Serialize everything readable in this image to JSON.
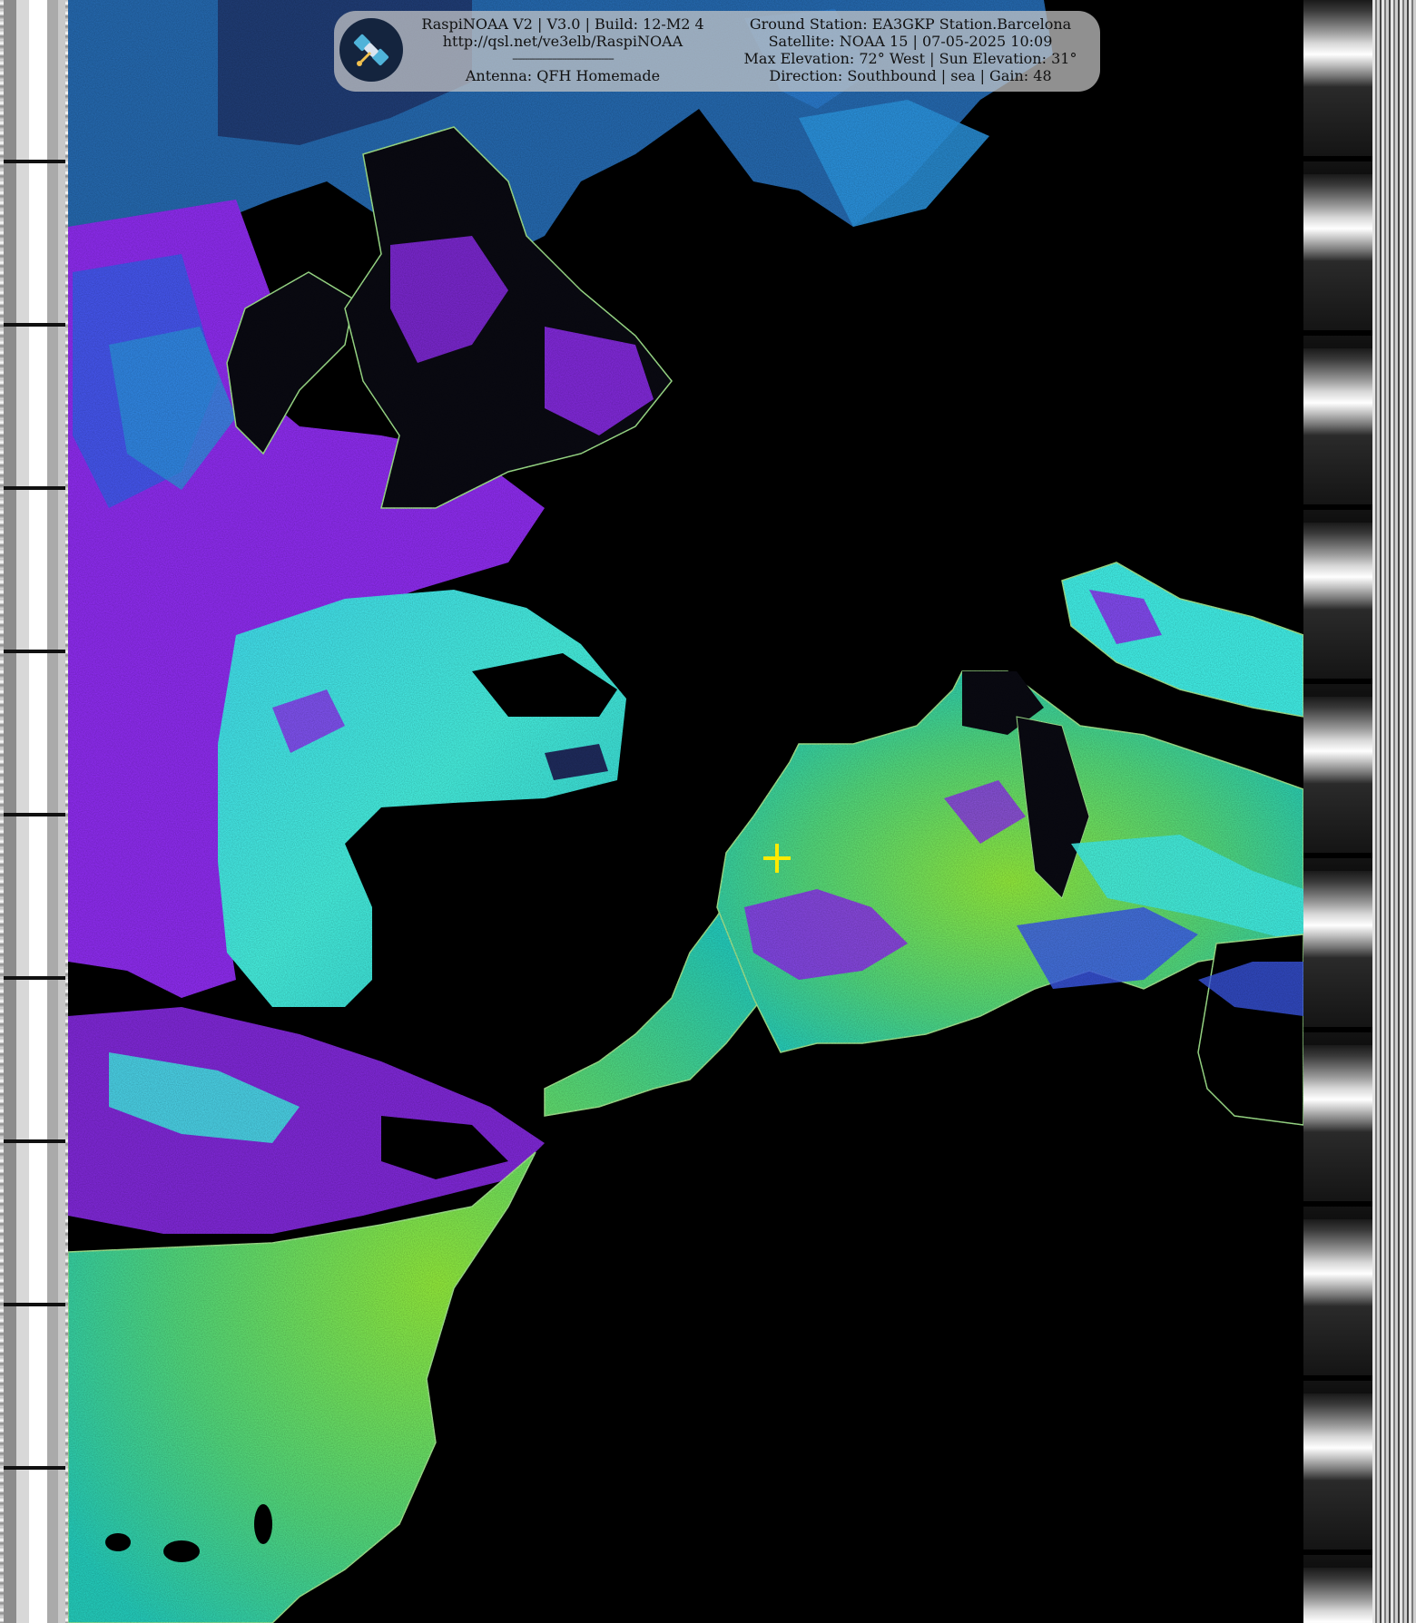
{
  "overlay": {
    "left_lines": [
      "RaspiNOAA V2 | V3.0 | Build: 12-M2 4",
      "http://qsl.net/ve3elb/RaspiNOAA",
      "-----------------------------------------",
      "Antenna: QFH Homemade"
    ],
    "right_lines": [
      "Ground Station: EA3GKP Station.Barcelona",
      "Satellite: NOAA 15 | 07-05-2025 10:09",
      "Max Elevation: 72° West | Sun Elevation: 31°",
      "Direction: Southbound | sea | Gain: 48"
    ],
    "logo_icon": "satellite-icon"
  },
  "imagery": {
    "palette": {
      "sea": "#000000",
      "land_warm": "#7be23a",
      "land_mid": "#2fd0a5",
      "cloud_cyan": "#3fe8e0",
      "cloud_blue": "#3b58e6",
      "cloud_violet": "#8a2be8",
      "coastline": "#9ee08a",
      "marker": "#ffea00"
    },
    "marker_icon": "crosshair-icon"
  }
}
